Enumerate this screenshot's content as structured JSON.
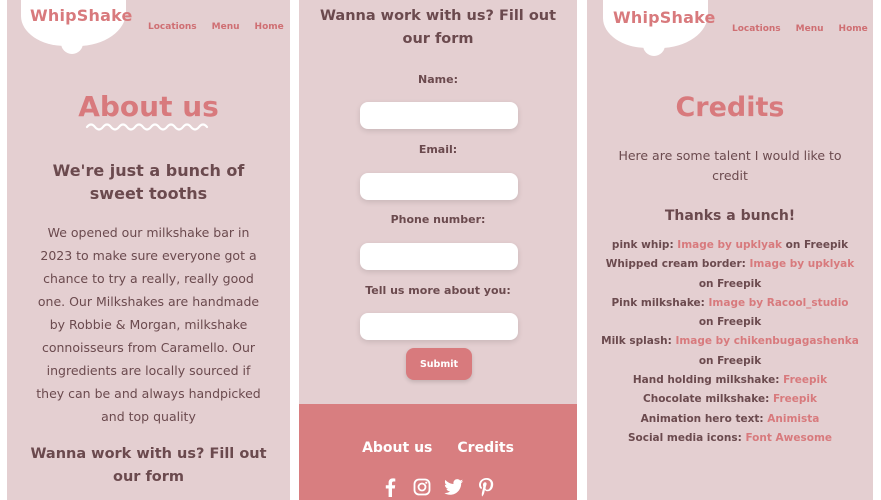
{
  "brand": {
    "name": "WhipShake",
    "accent": "#d87a7d",
    "background": "#e4cfd1"
  },
  "nav": {
    "items": [
      "Locations",
      "Menu",
      "Home"
    ]
  },
  "about": {
    "title": "About us",
    "subtitle_line1": "We're just a bunch of",
    "subtitle_line2": "sweet tooths",
    "paragraph_lines": [
      "We opened our milkshake bar in",
      "2023 to make sure everyone got a",
      "chance to try a really, really good",
      "one. Our Milkshakes are handmade",
      "by Robbie & Morgan, milkshake",
      "connoisseurs from Caramello. Our",
      "ingredients are locally sourced if",
      "they can be and always handpicked",
      "and top quality"
    ],
    "cta_line1": "Wanna work with us? Fill out",
    "cta_line2": "our form"
  },
  "form": {
    "heading_line1": "Wanna work with us? Fill out",
    "heading_line2": "our form",
    "fields": [
      {
        "label": "Name:",
        "value": ""
      },
      {
        "label": "Email:",
        "value": ""
      },
      {
        "label": "Phone number:",
        "value": ""
      },
      {
        "label": "Tell us more about you:",
        "value": ""
      }
    ],
    "submit_label": "Submit"
  },
  "footer": {
    "links": [
      "About us",
      "Credits"
    ],
    "social_icons": [
      "facebook-icon",
      "instagram-icon",
      "twitter-icon",
      "pinterest-icon"
    ]
  },
  "credits": {
    "title": "Credits",
    "intro_line1": "Here are some talent I would like to",
    "intro_line2": "credit",
    "thanks": "Thanks a bunch!",
    "items": [
      {
        "prefix": "pink whip: ",
        "link": "Image by upklyak",
        "suffix": " on Freepik"
      },
      {
        "prefix": "Whipped cream border: ",
        "link": "Image by upklyak",
        "suffix": "on Freepik"
      },
      {
        "prefix": "Pink milkshake: ",
        "link": "Image by Racool_studio",
        "suffix": "on Freepik"
      },
      {
        "prefix": "Milk splash: ",
        "link": "Image by chikenbugagashenka",
        "suffix": " on Freepik"
      },
      {
        "prefix": "Hand holding milkshake: ",
        "link": "Freepik",
        "suffix": ""
      },
      {
        "prefix": "Chocolate milkshake: ",
        "link": "Freepik",
        "suffix": ""
      },
      {
        "prefix": "Animation hero text: ",
        "link": "Animista",
        "suffix": ""
      },
      {
        "prefix": "Social media icons: ",
        "link": "Font Awesome",
        "suffix": ""
      }
    ]
  }
}
